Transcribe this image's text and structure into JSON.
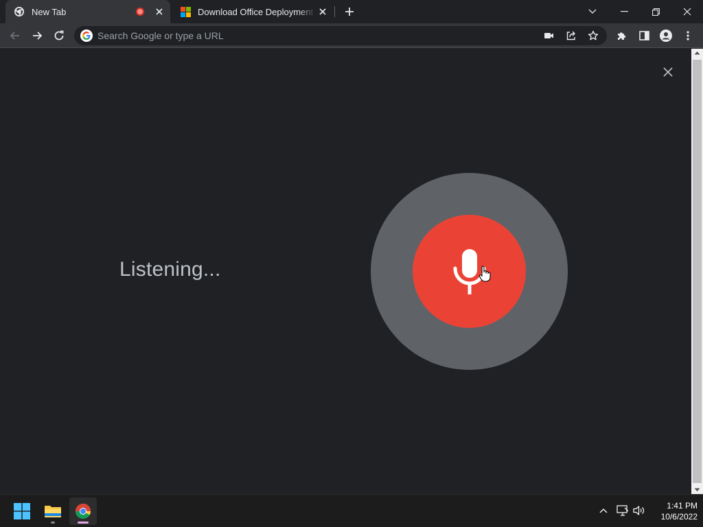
{
  "tabs": [
    {
      "title": "New Tab",
      "active": true,
      "favicon": "chrome-icon",
      "recording": true
    },
    {
      "title": "Download Office Deployment Tool",
      "active": false,
      "favicon": "microsoft-icon"
    }
  ],
  "omnibox": {
    "placeholder": "Search Google or type a URL"
  },
  "voice_search": {
    "status_text": "Listening..."
  },
  "colors": {
    "mic_red": "#ea4335",
    "mic_ring": "#5f6368",
    "background": "#202124"
  },
  "taskbar": {
    "apps": [
      "windows-start-icon",
      "file-explorer-icon",
      "chrome-icon"
    ],
    "time": "1:41 PM",
    "date": "10/6/2022"
  }
}
